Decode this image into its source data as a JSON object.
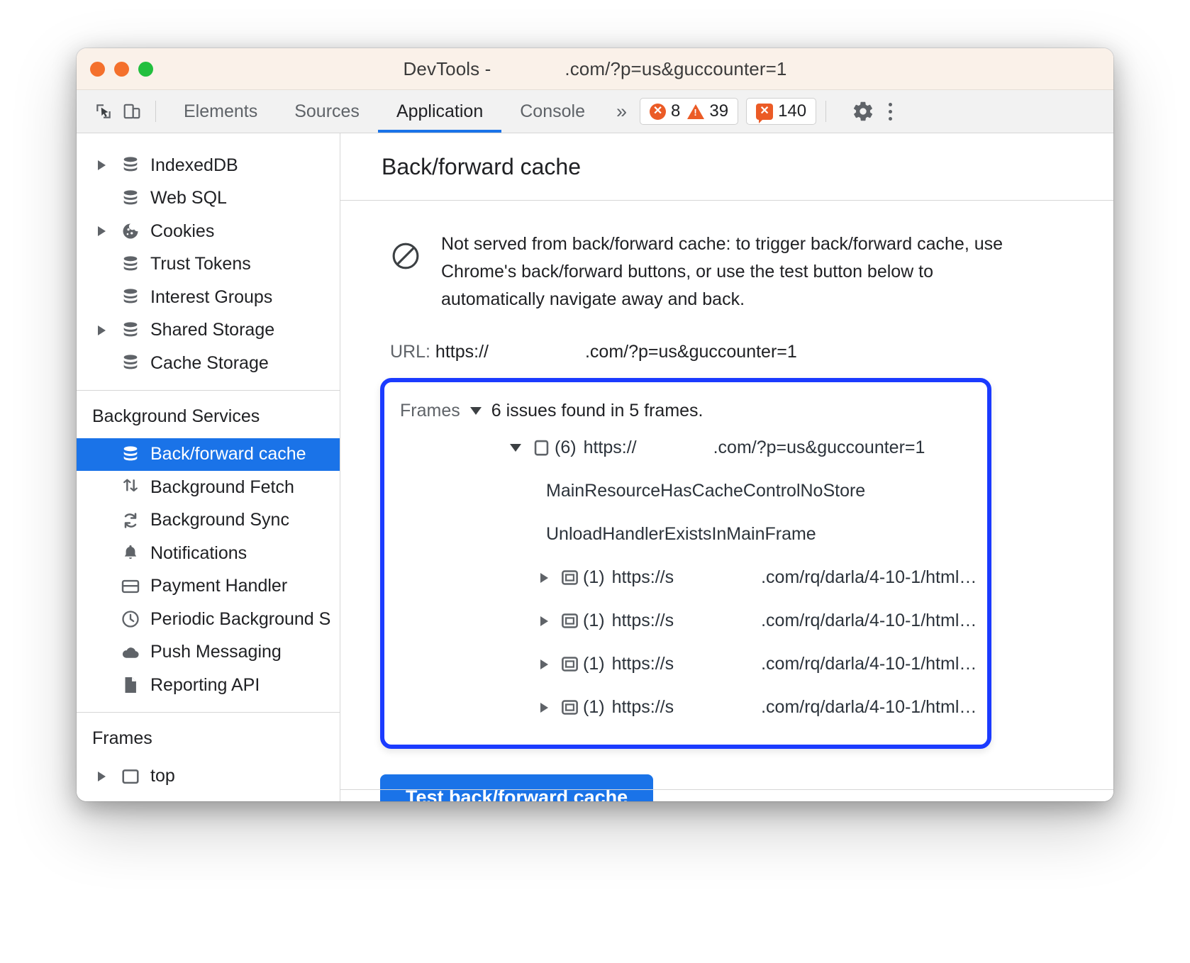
{
  "window": {
    "title_prefix": "DevTools -",
    "title_host_redacted": "",
    "title_suffix": ".com/?p=us&guccounter=1",
    "traffic_lights": [
      "close-red",
      "minimize-yellow",
      "maximize-green"
    ],
    "colors": {
      "titlebar_bg": "#faf1e9",
      "accent_blue": "#1a73e8",
      "highlight_outline": "#1b3bff",
      "badge_orange": "#eb5b26",
      "green_light": "#22bf3e",
      "red_light": "#f4702c"
    }
  },
  "toolbar": {
    "inspect_icon": "cursor-select-icon",
    "device_icon": "device-toolbar-icon",
    "tabs": [
      {
        "label": "Elements",
        "active": false
      },
      {
        "label": "Sources",
        "active": false
      },
      {
        "label": "Application",
        "active": true
      },
      {
        "label": "Console",
        "active": false
      }
    ],
    "more_tabs": "»",
    "counters": {
      "errors": "8",
      "warnings": "39",
      "issues": "140"
    },
    "settings_icon": "gear-icon",
    "menu_icon": "kebab-menu-icon"
  },
  "sidebar": {
    "storage_items": [
      {
        "label": "IndexedDB",
        "icon": "database-icon",
        "expandable": true
      },
      {
        "label": "Web SQL",
        "icon": "database-icon",
        "expandable": false
      },
      {
        "label": "Cookies",
        "icon": "cookie-icon",
        "expandable": true
      },
      {
        "label": "Trust Tokens",
        "icon": "database-icon",
        "expandable": false
      },
      {
        "label": "Interest Groups",
        "icon": "database-icon",
        "expandable": false
      },
      {
        "label": "Shared Storage",
        "icon": "database-icon",
        "expandable": true
      },
      {
        "label": "Cache Storage",
        "icon": "database-icon",
        "expandable": false
      }
    ],
    "background_services_title": "Background Services",
    "background_services_items": [
      {
        "label": "Back/forward cache",
        "icon": "database-icon",
        "selected": true
      },
      {
        "label": "Background Fetch",
        "icon": "fetch-arrows-icon",
        "selected": false
      },
      {
        "label": "Background Sync",
        "icon": "sync-icon",
        "selected": false
      },
      {
        "label": "Notifications",
        "icon": "bell-icon",
        "selected": false
      },
      {
        "label": "Payment Handler",
        "icon": "credit-card-icon",
        "selected": false
      },
      {
        "label": "Periodic Background S",
        "icon": "clock-icon",
        "selected": false
      },
      {
        "label": "Push Messaging",
        "icon": "cloud-icon",
        "selected": false
      },
      {
        "label": "Reporting API",
        "icon": "document-icon",
        "selected": false
      }
    ],
    "frames_title": "Frames",
    "frames_items": [
      {
        "label": "top",
        "icon": "frame-icon",
        "expandable": true
      }
    ]
  },
  "main": {
    "panel_title": "Back/forward cache",
    "status_icon": "blocked-circle-icon",
    "status_message": "Not served from back/forward cache: to trigger back/forward cache, use Chrome's back/forward buttons, or use the test button below to automatically navigate away and back.",
    "url_label": "URL:",
    "url_scheme": "https://",
    "url_host_redacted": "",
    "url_path": ".com/?p=us&guccounter=1",
    "frames_section": {
      "label": "Frames",
      "toggle_icon": "chevron-down-icon",
      "summary": "6 issues found in 5 frames.",
      "main_frame": {
        "expanded": true,
        "toggle_icon": "chevron-down-icon",
        "icon": "frame-icon",
        "count": "(6)",
        "scheme": "https://",
        "host_redacted": "",
        "path": ".com/?p=us&guccounter=1",
        "issues": [
          "MainResourceHasCacheControlNoStore",
          "UnloadHandlerExistsInMainFrame"
        ]
      },
      "subframes": [
        {
          "expanded": false,
          "toggle_icon": "chevron-right-icon",
          "icon": "iframe-icon",
          "count": "(1)",
          "scheme": "https://",
          "host_redacted": "s",
          "path": ".com/rq/darla/4-10-1/html…"
        },
        {
          "expanded": false,
          "toggle_icon": "chevron-right-icon",
          "icon": "iframe-icon",
          "count": "(1)",
          "scheme": "https://",
          "host_redacted": "s",
          "path": ".com/rq/darla/4-10-1/html…"
        },
        {
          "expanded": false,
          "toggle_icon": "chevron-right-icon",
          "icon": "iframe-icon",
          "count": "(1)",
          "scheme": "https://",
          "host_redacted": "s",
          "path": ".com/rq/darla/4-10-1/html…"
        },
        {
          "expanded": false,
          "toggle_icon": "chevron-right-icon",
          "icon": "iframe-icon",
          "count": "(1)",
          "scheme": "https://",
          "host_redacted": "s",
          "path": ".com/rq/darla/4-10-1/html…"
        }
      ]
    },
    "test_button_label": "Test back/forward cache"
  }
}
